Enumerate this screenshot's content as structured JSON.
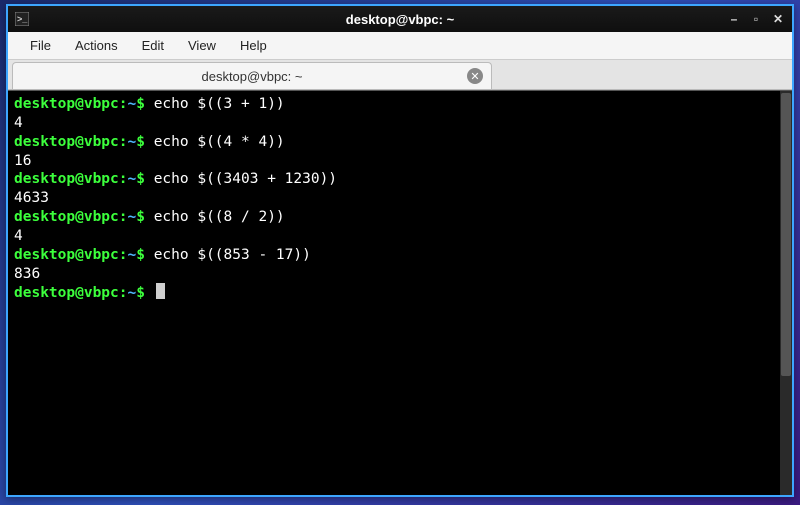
{
  "window": {
    "title": "desktop@vbpc: ~"
  },
  "menu": {
    "file": "File",
    "actions": "Actions",
    "edit": "Edit",
    "view": "View",
    "help": "Help"
  },
  "tab": {
    "label": "desktop@vbpc: ~"
  },
  "prompt": {
    "user_host": "desktop@vbpc",
    "sep": ":",
    "path": "~",
    "sigil": "$"
  },
  "lines": [
    {
      "cmd": "echo $((3 + 1))",
      "out": "4"
    },
    {
      "cmd": "echo $((4 * 4))",
      "out": "16"
    },
    {
      "cmd": "echo $((3403 + 1230))",
      "out": "4633"
    },
    {
      "cmd": "echo $((8 / 2))",
      "out": "4"
    },
    {
      "cmd": "echo $((853 - 17))",
      "out": "836"
    }
  ],
  "colors": {
    "prompt_user": "#3cff3c",
    "prompt_path": "#4fb8ff",
    "border": "#3da6ff"
  }
}
